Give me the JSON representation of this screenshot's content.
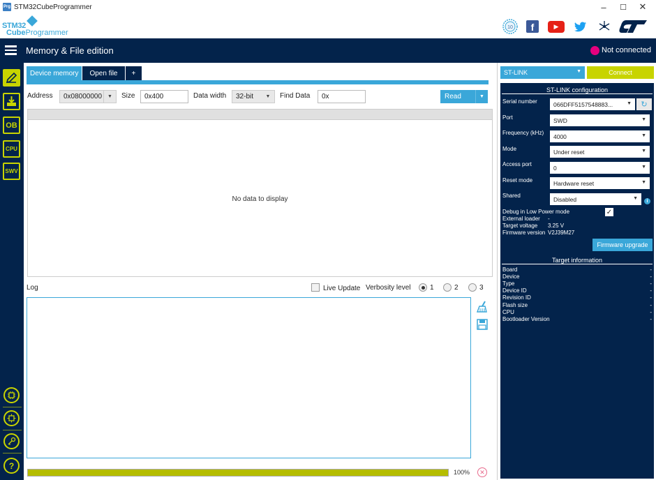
{
  "window": {
    "title": "STM32CubeProgrammer",
    "icon": "Prg",
    "minimize": "–",
    "maximize": "☐",
    "close": "✕"
  },
  "brand": {
    "logo_line1": "STM32",
    "logo_line2a": "Cube",
    "logo_line2b": "Programmer",
    "social_icons": [
      "anniversary-badge-icon",
      "facebook-icon",
      "youtube-icon",
      "twitter-icon",
      "network-icon",
      "st-logo-icon"
    ],
    "anniv_label": "10",
    "facebook_label": "f",
    "youtube_label": "▶",
    "twitter_label": "🐦",
    "network_label": "✣",
    "st_label": "ST"
  },
  "topbar": {
    "title": "Memory & File edition",
    "status": "Not connected"
  },
  "sidebar": {
    "items": [
      "",
      "",
      "OB",
      "CPU",
      "SWV"
    ],
    "bottom": [
      "",
      "",
      "",
      "?"
    ]
  },
  "main": {
    "tabs": [
      "Device memory",
      "Open file",
      "+"
    ],
    "address_label": "Address",
    "address_value": "0x08000000",
    "size_label": "Size",
    "size_value": "0x400",
    "data_width_label": "Data width",
    "data_width_value": "32-bit",
    "find_label": "Find Data",
    "find_value": "0x",
    "read_label": "Read",
    "no_data": "No data to display",
    "log_label": "Log",
    "live_update_label": "Live Update",
    "verbosity_label": "Verbosity level",
    "verbosity_options": [
      "1",
      "2",
      "3"
    ],
    "verbosity_selected": "1",
    "progress_percent": 100,
    "progress_text": "100%"
  },
  "right": {
    "interface": "ST-LINK",
    "connect_label": "Connect",
    "config_title": "ST-LINK configuration",
    "fields": [
      {
        "label": "Serial number",
        "value": "066DFF5157548883..."
      },
      {
        "label": "Port",
        "value": "SWD"
      },
      {
        "label": "Frequency (kHz)",
        "value": "4000"
      },
      {
        "label": "Mode",
        "value": "Under reset"
      },
      {
        "label": "Access port",
        "value": "0"
      },
      {
        "label": "Reset mode",
        "value": "Hardware reset"
      },
      {
        "label": "Shared",
        "value": "Disabled"
      }
    ],
    "debug_low_power_label": "Debug in Low Power mode",
    "debug_low_power_checked": true,
    "external_loader_label": "External loader",
    "external_loader_value": "-",
    "target_voltage_label": "Target voltage",
    "target_voltage_value": "3.25 V",
    "firmware_version_label": "Firmware version",
    "firmware_version_value": "V2J39M27",
    "firmware_upgrade_label": "Firmware upgrade",
    "target_info_title": "Target information",
    "target_info": [
      {
        "label": "Board",
        "value": "-"
      },
      {
        "label": "Device",
        "value": "-"
      },
      {
        "label": "Type",
        "value": "-"
      },
      {
        "label": "Device ID",
        "value": "-"
      },
      {
        "label": "Revision ID",
        "value": "-"
      },
      {
        "label": "Flash size",
        "value": "-"
      },
      {
        "label": "CPU",
        "value": "-"
      },
      {
        "label": "Bootloader Version",
        "value": "-"
      }
    ]
  },
  "colors": {
    "navy": "#03234b",
    "accent_blue": "#3aa7d9",
    "lime": "#c8d400",
    "status_dot": "#e6007e"
  }
}
